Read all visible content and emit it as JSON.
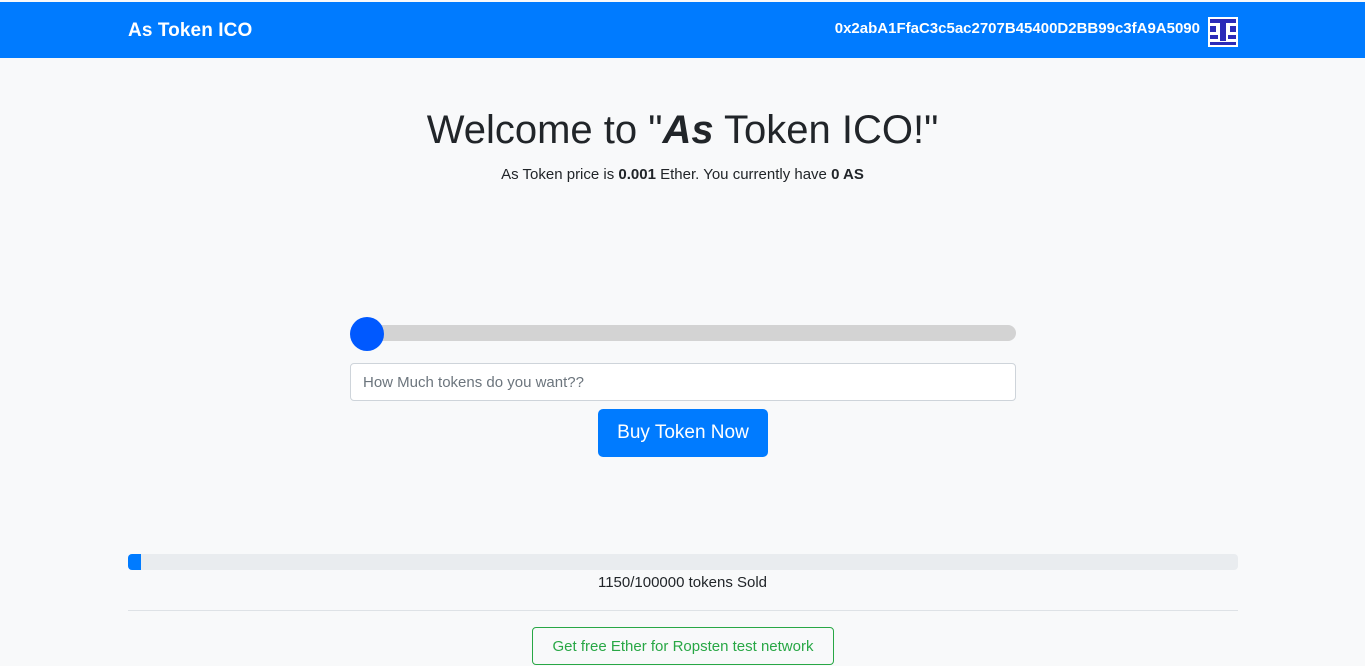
{
  "navbar": {
    "brand": "As Token ICO",
    "account": "0x2abA1FfaC3c5ac2707B45400D2BB99c3fA9A5090",
    "avatar_icon": "identicon"
  },
  "hero": {
    "title_before": "Welcome to \"",
    "title_emph": "As",
    "title_after": " Token ICO!\"",
    "price_prefix": "As Token price is ",
    "price_value": "0.001",
    "price_mid": " Ether. You currently have ",
    "balance": "0 AS"
  },
  "purchase": {
    "slider_value": 0,
    "input_placeholder": "How Much tokens do you want??",
    "buy_label": "Buy Token Now"
  },
  "sale": {
    "tokens_sold": 1150,
    "tokens_total": 100000,
    "sold_text": "1150/100000 tokens Sold",
    "ether_button_label": "Get free Ether for Ropsten test network"
  },
  "colors": {
    "primary": "#007bff",
    "success": "#28a745"
  }
}
